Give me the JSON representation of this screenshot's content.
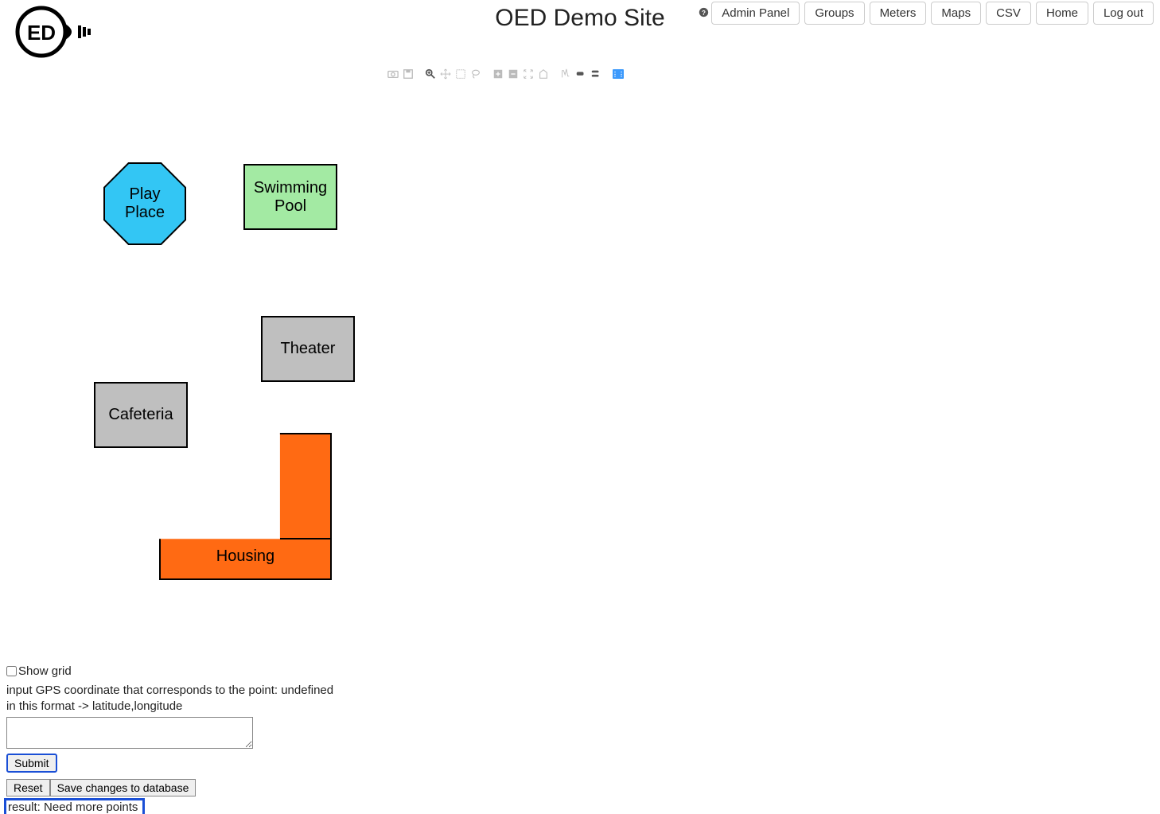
{
  "header": {
    "title": "OED Demo Site",
    "nav": {
      "admin_panel": "Admin Panel",
      "groups": "Groups",
      "meters": "Meters",
      "maps": "Maps",
      "csv": "CSV",
      "home": "Home",
      "logout": "Log out"
    }
  },
  "map": {
    "buildings": {
      "play_place": "Play Place",
      "swimming_pool": "Swimming Pool",
      "theater": "Theater",
      "cafeteria": "Cafeteria",
      "housing": "Housing"
    }
  },
  "controls": {
    "show_grid_label": "Show grid",
    "instruction_line1": "input GPS coordinate that corresponds to the point: undefined",
    "instruction_line2": "in this format -> latitude,longitude",
    "gps_value": "",
    "submit_label": "Submit",
    "reset_label": "Reset",
    "save_label": "Save changes to database",
    "result_text": "result: Need more points"
  }
}
